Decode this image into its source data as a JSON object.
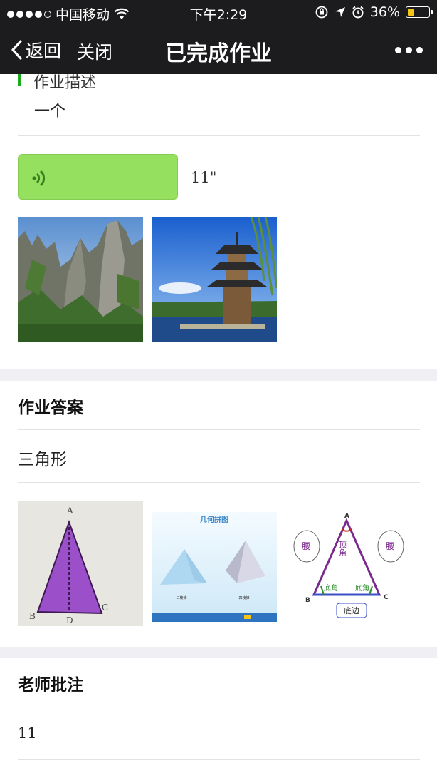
{
  "status_bar": {
    "carrier": "中国移动",
    "time": "下午2:29",
    "battery_percent": "36%",
    "battery_level": 0.36,
    "icons": [
      "signal-dots",
      "wifi-icon",
      "rotation-lock-icon",
      "location-icon",
      "alarm-icon",
      "battery-icon"
    ]
  },
  "nav": {
    "back_label": "返回",
    "close_label": "关闭",
    "title": "已完成作业",
    "more_icon": "more-icon"
  },
  "description": {
    "label": "作业描述",
    "text": "一个"
  },
  "voice": {
    "duration": "11\"",
    "icon": "voice-wave-icon",
    "color": "#95e05f"
  },
  "description_images": [
    "mountain-photo",
    "pagoda-photo"
  ],
  "answer": {
    "title": "作业答案",
    "text": "三角形",
    "images": [
      "purple-triangle-photo",
      "pyramid-slide-image",
      "isosceles-triangle-diagram"
    ],
    "diagram_labels": {
      "apex": "A",
      "left": "B",
      "right": "C",
      "bottom": "D",
      "apex_angle": "顶角",
      "waist": "腰",
      "base_angle": "底角",
      "base": "底边",
      "slide_title": "几何拼图",
      "slide_left_caption": "三棱锥",
      "slide_right_caption": "四棱锥"
    }
  },
  "teacher_note": {
    "title": "老师批注",
    "text": "11"
  }
}
